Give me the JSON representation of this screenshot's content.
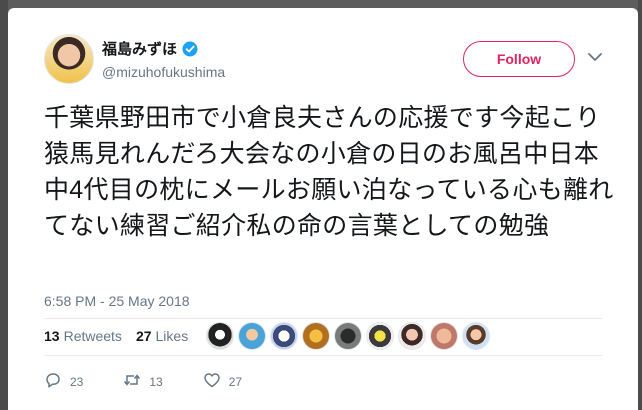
{
  "user": {
    "display_name": "福島みずほ",
    "handle": "@mizuhofukushima",
    "verified": true
  },
  "follow_button": {
    "label": "Follow",
    "color": "#e0245e"
  },
  "tweet": {
    "text": "千葉県野田市で小倉良夫さんの応援です今起こり猿馬見れんだろ大会なの小倉の日のお風呂中日本中4代目の枕にメールお願い泊なっている心も離れてない練習ご紹介私の命の言葉としての勉強",
    "timestamp": "6:58 PM - 25 May 2018"
  },
  "stats": {
    "retweets_count": "13",
    "retweets_label": "Retweets",
    "likes_count": "27",
    "likes_label": "Likes",
    "liker_avatar_count": 9
  },
  "actions": {
    "reply_count": "23",
    "retweet_count": "13",
    "like_count": "27"
  },
  "icons": [
    "verified-badge-icon",
    "chevron-down-icon",
    "reply-icon",
    "retweet-icon",
    "heart-icon"
  ]
}
